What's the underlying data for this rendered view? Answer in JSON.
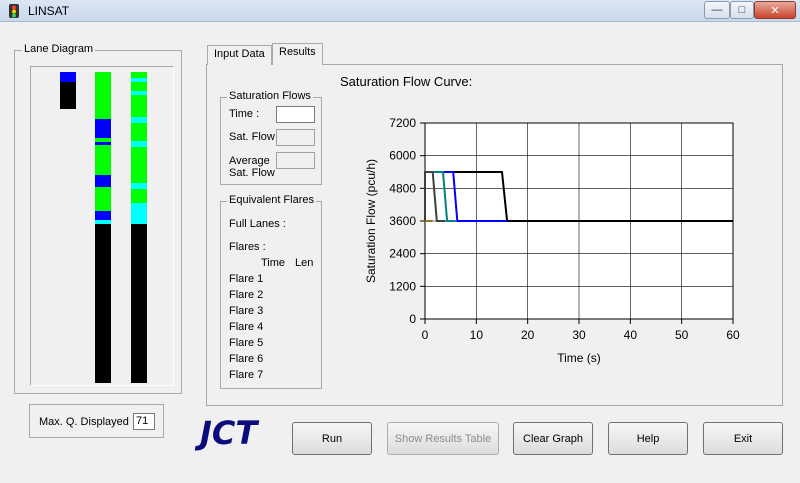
{
  "window": {
    "title": "LINSAT"
  },
  "lane_diagram": {
    "label": "Lane Diagram",
    "max_q_label": "Max. Q. Displayed",
    "max_q_value": "71"
  },
  "tabs": [
    {
      "label": "Input Data",
      "active": false
    },
    {
      "label": "Results",
      "active": true
    }
  ],
  "saturation_flows": {
    "label": "Saturation Flows",
    "time_label": "Time :",
    "sat_flow_label": "Sat. Flow",
    "average_label_1": "Average",
    "average_label_2": "Sat. Flow"
  },
  "equivalent_flares": {
    "label": "Equivalent Flares",
    "full_lanes_label": "Full Lanes :",
    "flares_label": "Flares :",
    "col_time": "Time",
    "col_len": "Len",
    "flares": [
      "Flare 1",
      "Flare 2",
      "Flare 3",
      "Flare 4",
      "Flare 5",
      "Flare 6",
      "Flare 7"
    ]
  },
  "logo_text": "JCT",
  "buttons": {
    "run": "Run",
    "show_results": "Show Results Table",
    "clear_graph": "Clear Graph",
    "help": "Help",
    "exit": "Exit"
  },
  "colors": {
    "green": "#00ff00",
    "blue": "#0000ff",
    "cyan": "#00ffff",
    "black": "#000000",
    "logo": "#0b0b80"
  },
  "chart_data": {
    "type": "line",
    "title": "Saturation Flow Curve:",
    "xlabel": "Time (s)",
    "ylabel": "Saturation Flow (pcu/h)",
    "xlim": [
      0,
      60
    ],
    "ylim": [
      0,
      7200
    ],
    "xticks": [
      0,
      10,
      20,
      30,
      40,
      50,
      60
    ],
    "yticks": [
      0,
      1200,
      2400,
      3600,
      4800,
      6000,
      7200
    ],
    "grid": true,
    "series": [
      {
        "color": "#000000",
        "x": [
          0,
          0,
          15,
          16,
          60
        ],
        "y": [
          3600,
          5400,
          5400,
          3600,
          3600
        ]
      },
      {
        "color": "#0000ff",
        "x": [
          0,
          0,
          5.5,
          6.3,
          16
        ],
        "y": [
          3600,
          5400,
          5400,
          3600,
          3600
        ]
      },
      {
        "color": "#008080",
        "x": [
          0,
          0,
          3.5,
          4.3,
          6
        ],
        "y": [
          3600,
          5400,
          5400,
          3600,
          3600
        ]
      },
      {
        "color": "#404040",
        "x": [
          0,
          0,
          1.5,
          2.3,
          4
        ],
        "y": [
          3600,
          5400,
          5400,
          3600,
          3600
        ]
      },
      {
        "color": "#8a7a20",
        "x": [
          0,
          1.5
        ],
        "y": [
          3600,
          3600
        ]
      }
    ]
  }
}
